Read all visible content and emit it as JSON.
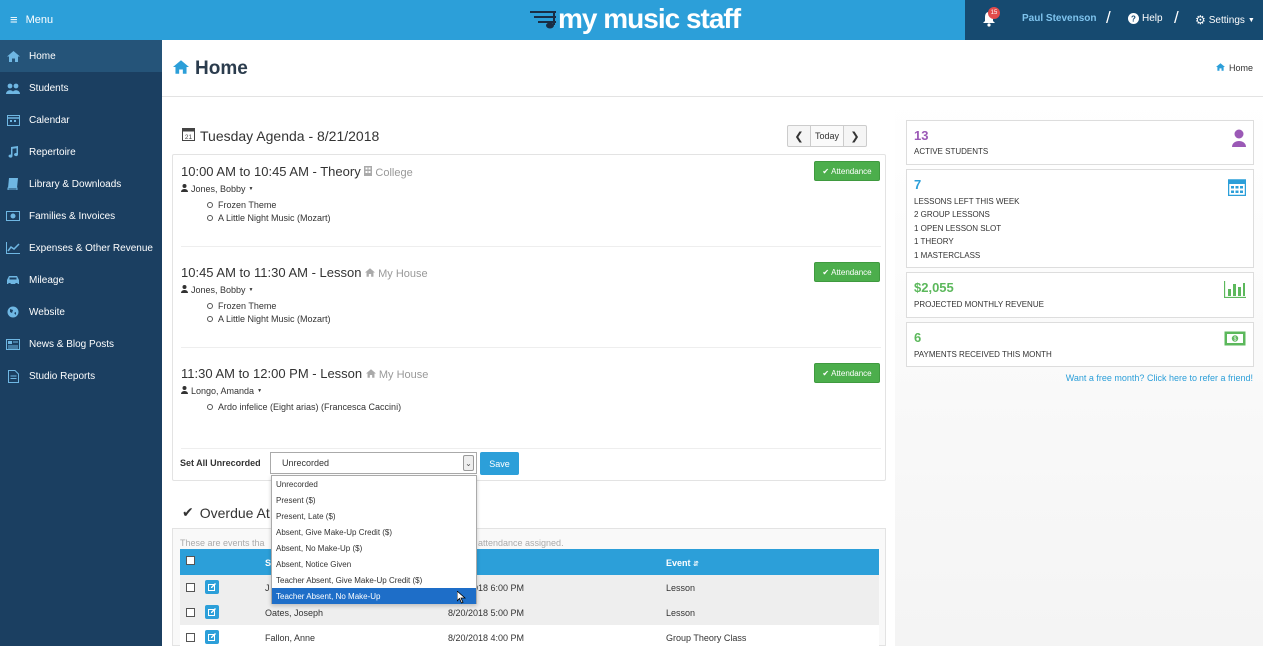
{
  "topbar": {
    "menu_label": "Menu",
    "logo_text": "my music staff",
    "notification_count": "15",
    "user_name": "Paul Stevenson",
    "help_label": "Help",
    "settings_label": "Settings",
    "separator": "/"
  },
  "sidebar": {
    "items": [
      {
        "label": "Home",
        "icon": "home-icon"
      },
      {
        "label": "Students",
        "icon": "users-icon"
      },
      {
        "label": "Calendar",
        "icon": "calendar-icon"
      },
      {
        "label": "Repertoire",
        "icon": "music-note-icon"
      },
      {
        "label": "Library & Downloads",
        "icon": "book-icon"
      },
      {
        "label": "Families & Invoices",
        "icon": "money-icon"
      },
      {
        "label": "Expenses & Other Revenue",
        "icon": "line-chart-icon"
      },
      {
        "label": "Mileage",
        "icon": "car-icon"
      },
      {
        "label": "Website",
        "icon": "globe-icon"
      },
      {
        "label": "News & Blog Posts",
        "icon": "newspaper-icon"
      },
      {
        "label": "Studio Reports",
        "icon": "report-icon"
      }
    ]
  },
  "header": {
    "title": "Home",
    "breadcrumb": "Home"
  },
  "agenda": {
    "title": "Tuesday Agenda - 8/21/2018",
    "calendar_day": "21",
    "today_label": "Today",
    "attendance_label": "Attendance",
    "lessons": [
      {
        "time": "10:00 AM to 10:45 AM - Theory",
        "location": "College",
        "student": "Jones, Bobby",
        "pieces": [
          "Frozen Theme",
          "A Little Night Music (Mozart)"
        ]
      },
      {
        "time": "10:45 AM to 11:30 AM - Lesson",
        "location": "My House",
        "student": "Jones, Bobby",
        "pieces": [
          "Frozen Theme",
          "A Little Night Music (Mozart)"
        ]
      },
      {
        "time": "11:30 AM to 12:00 PM - Lesson",
        "location": "My House",
        "student": "Longo, Amanda",
        "pieces": [
          "Ardo infelice (Eight arias) (Francesca Caccini)"
        ]
      }
    ],
    "set_all_label": "Set All Unrecorded",
    "select_value": "Unrecorded",
    "save_label": "Save"
  },
  "dropdown": {
    "options": [
      "Unrecorded",
      "Present ($)",
      "Present, Late ($)",
      "Absent, Give Make-Up Credit ($)",
      "Absent, No Make-Up ($)",
      "Absent, Notice Given",
      "Teacher Absent, Give Make-Up Credit ($)",
      "Teacher Absent, No Make-Up"
    ],
    "highlighted_index": 7
  },
  "overdue": {
    "title": "Overdue At",
    "description": "These are events tha",
    "description_end": "attendance assigned.",
    "headers": {
      "student": "S",
      "event": "Event"
    },
    "rows": [
      {
        "student": "J",
        "date": "8/21/2018 6:00 PM",
        "event": "Lesson"
      },
      {
        "student": "Oates, Joseph",
        "date": "8/20/2018 5:00 PM",
        "event": "Lesson"
      },
      {
        "student": "Fallon, Anne",
        "date": "8/20/2018 4:00 PM",
        "event": "Group Theory Class"
      }
    ]
  },
  "stats": {
    "active_students": {
      "value": "13",
      "label": "ACTIVE STUDENTS",
      "color": "#9b59b6"
    },
    "lessons": {
      "value": "7",
      "lines": [
        "LESSONS LEFT THIS WEEK",
        "2 GROUP LESSONS",
        "1 OPEN LESSON SLOT",
        "1 THEORY",
        "1 MASTERCLASS"
      ],
      "color": "#2c9fd9"
    },
    "revenue": {
      "value": "$2,055",
      "label": "PROJECTED MONTHLY REVENUE",
      "color": "#5cb85c"
    },
    "payments": {
      "value": "6",
      "label": "PAYMENTS RECEIVED THIS MONTH",
      "color": "#5cb85c"
    },
    "refer_link": "Want a free month? Click here to refer a friend!"
  }
}
